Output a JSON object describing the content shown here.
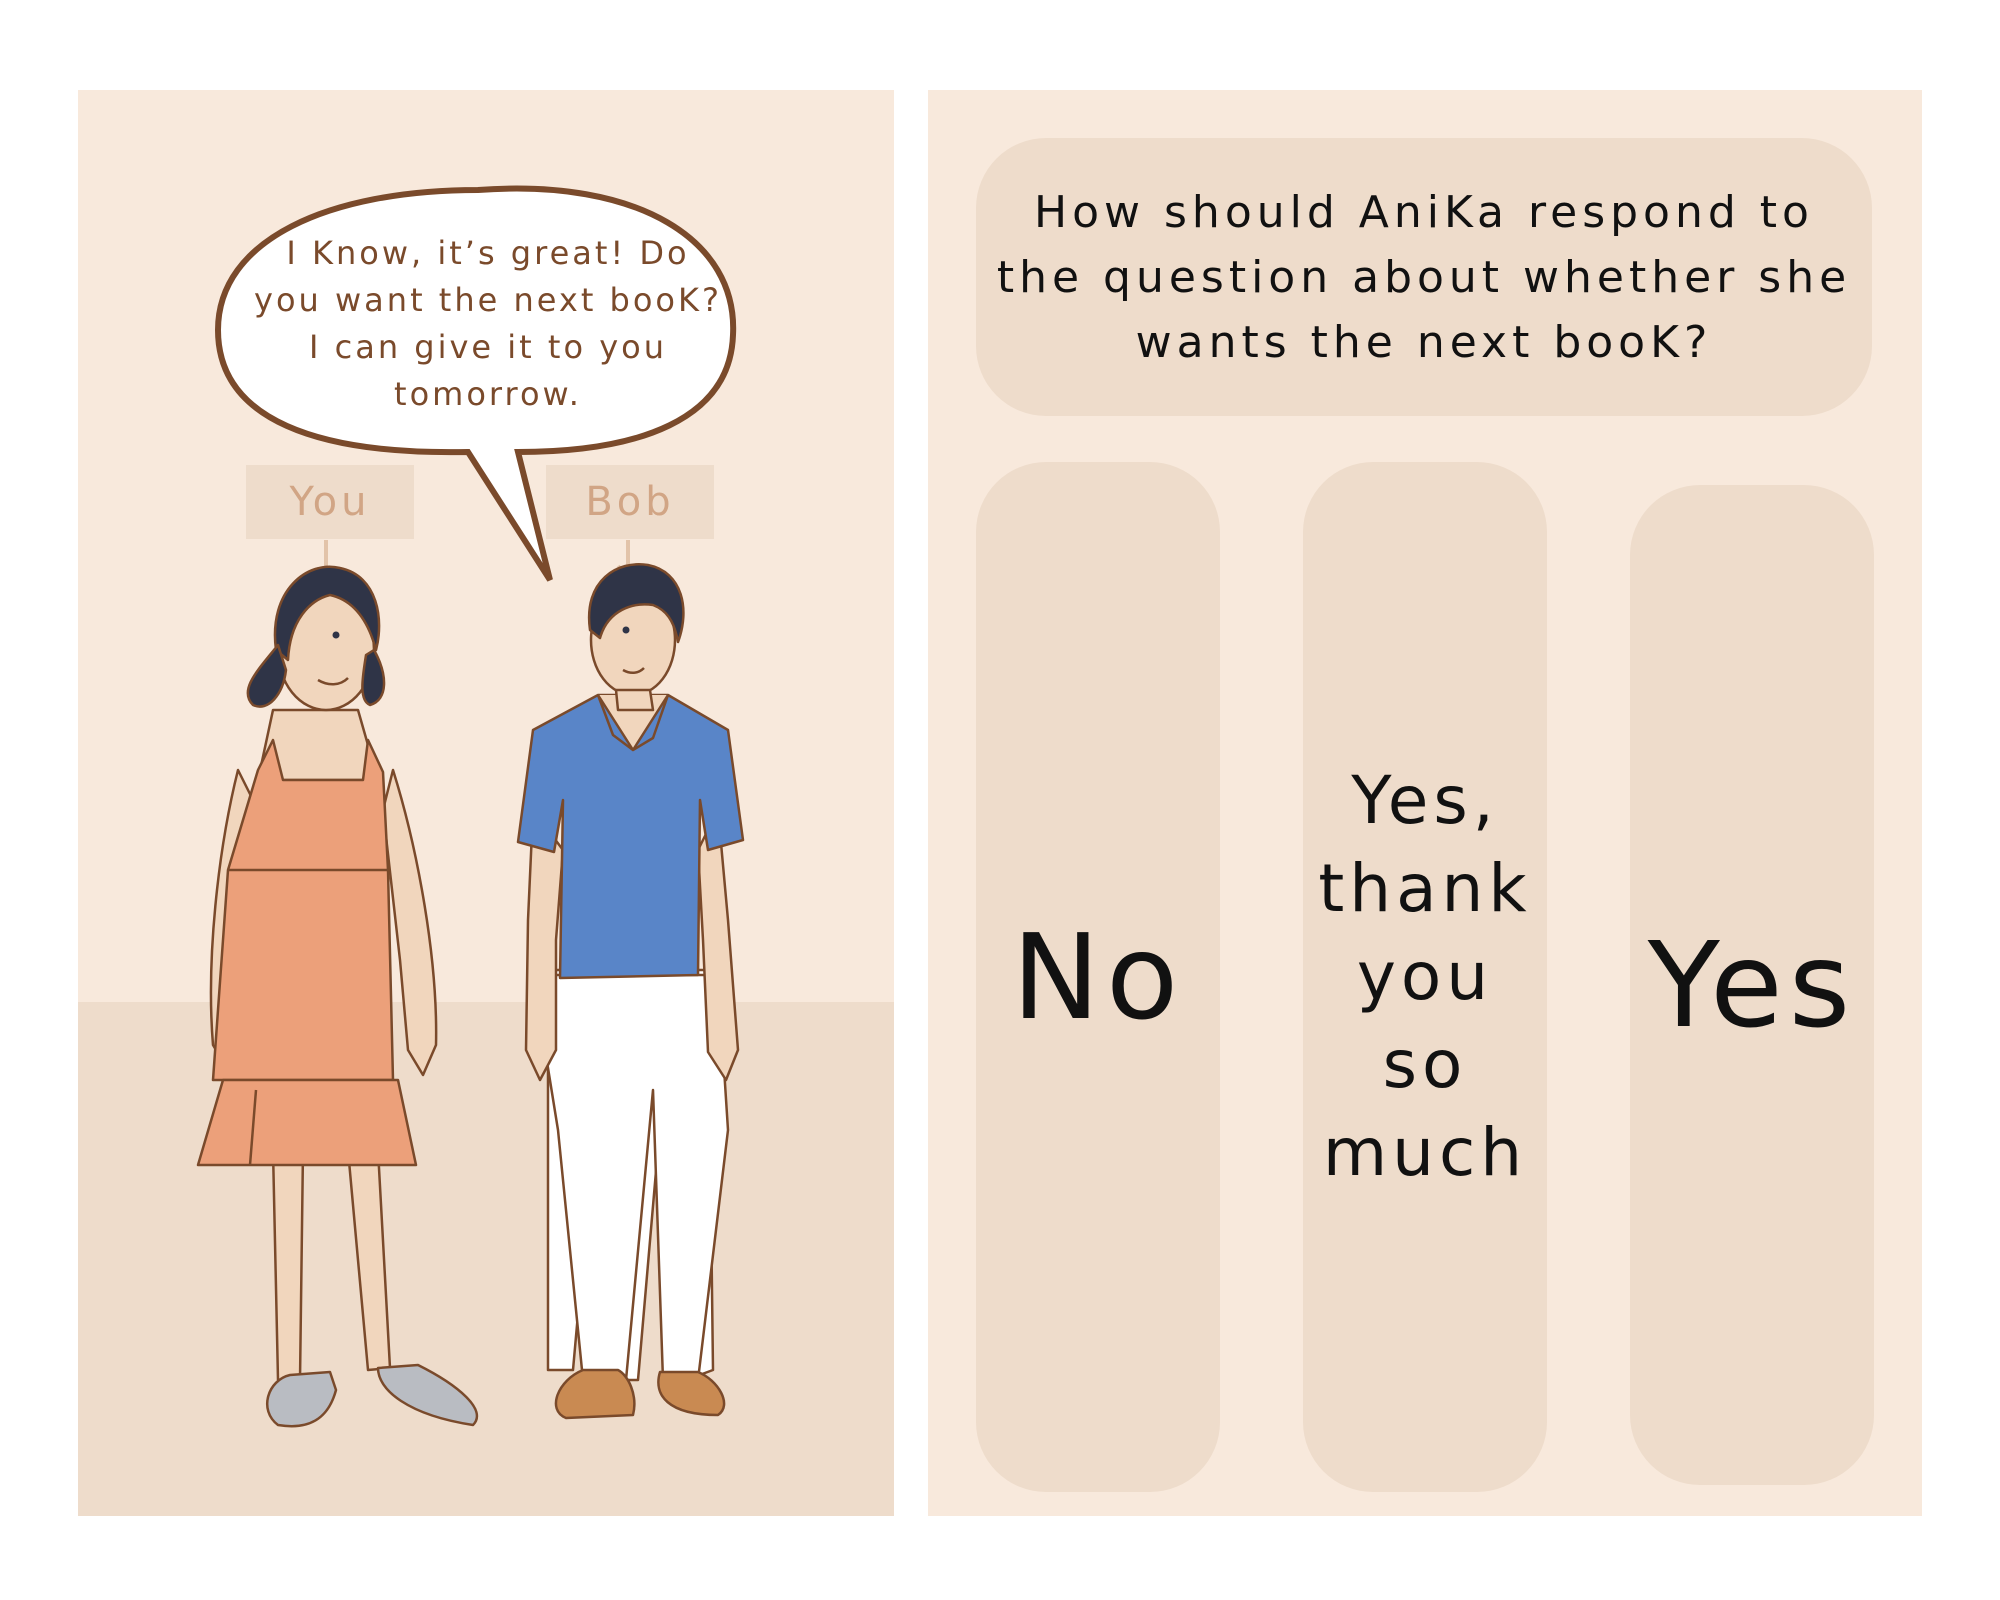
{
  "scene": {
    "speech_bubble": "I Know, it’s great! Do you want the next booK? I can give it to you tomorrow.",
    "label_you": "You",
    "label_bob": "Bob"
  },
  "quiz": {
    "question": "How should AniKa respond to the question about whether she wants the next booK?",
    "options": [
      "No",
      "Yes, thank you so much",
      "Yes"
    ]
  },
  "colors": {
    "panel_bg": "#f8e9dc",
    "floor_and_cards": "#eedccb",
    "label_text": "#d1a585",
    "bubble_outline": "#7a4a2b",
    "dress": "#eca07a",
    "shirt": "#5985c8",
    "hair": "#2f3447",
    "shoes_girl": "#b9bcc2",
    "shoes_boy": "#c98a52"
  }
}
